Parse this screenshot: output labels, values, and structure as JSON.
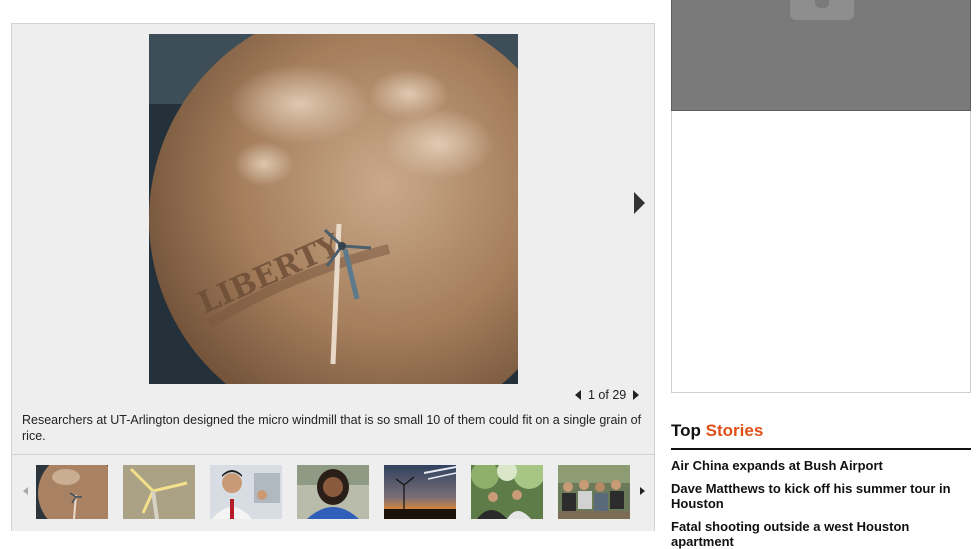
{
  "gallery": {
    "photo": {
      "subject": "micro windmill on a penny",
      "coin_text": "LIBERTY"
    },
    "next_icon": "triangle-right-icon",
    "pager": {
      "current": 1,
      "total": 29,
      "text": "1 of 29"
    },
    "caption": "Researchers at UT-Arlington designed the micro windmill that is so small 10 of them could fit on a single grain of rice.",
    "thumbnails": [
      {
        "subject": "micro windmill on penny"
      },
      {
        "subject": "micro windmill close-up"
      },
      {
        "subject": "researcher holding device"
      },
      {
        "subject": "woman in blue shirt"
      },
      {
        "subject": "wind turbines at sunset"
      },
      {
        "subject": "people outdoors under trees"
      },
      {
        "subject": "group of people sitting"
      }
    ]
  },
  "ad": {
    "icon": "ad-placeholder-icon"
  },
  "top_stories": {
    "heading_part1": "Top",
    "heading_part2": "Stories",
    "items": [
      "Air China expands at Bush Airport",
      "Dave Matthews to kick off his summer tour in Houston",
      "Fatal shooting outside a west Houston apartment"
    ]
  },
  "colors": {
    "accent": "#e0501b",
    "gallery_bg": "#eeeeee",
    "ad_bg": "#7a7a7a"
  }
}
